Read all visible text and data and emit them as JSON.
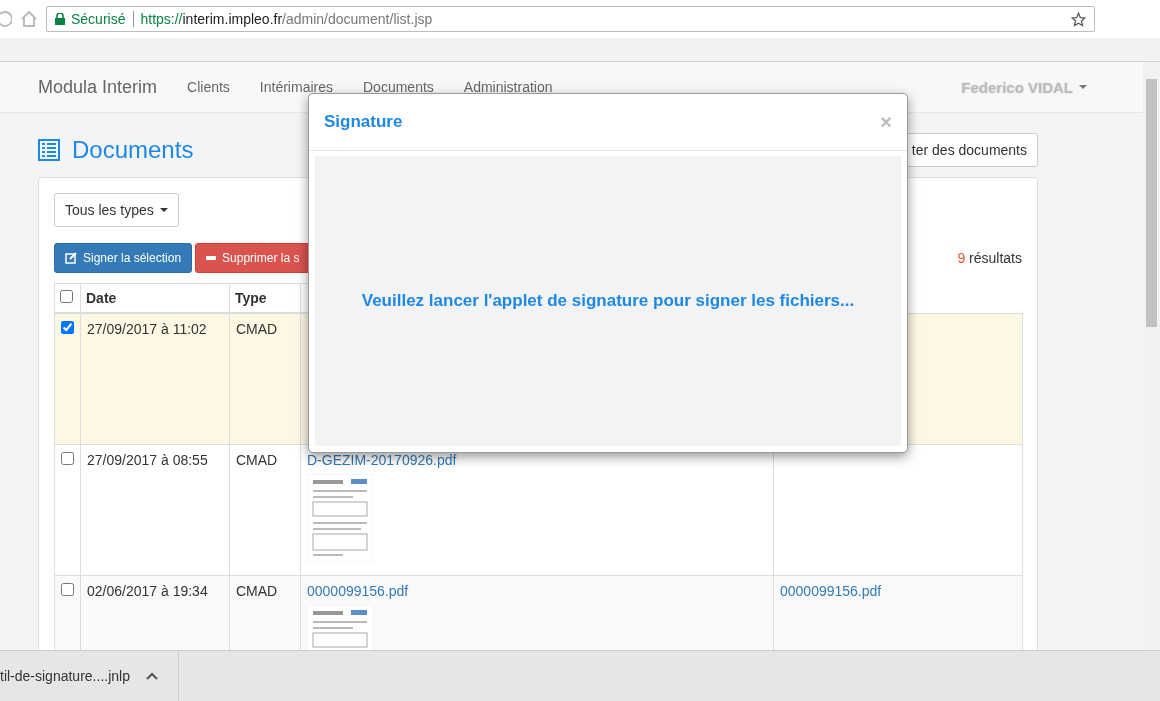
{
  "browser": {
    "secure_label": "Sécurisé",
    "url_scheme": "https://",
    "url_host": "interim.impleo.fr",
    "url_path": "/admin/document/list.jsp"
  },
  "navbar": {
    "brand": "Modula Interim",
    "links": [
      "Clients",
      "Intérimaires",
      "Documents",
      "Administration"
    ],
    "user": "Federico VIDAL"
  },
  "page": {
    "title": "Documents",
    "import_button": "ter des documents"
  },
  "filter": {
    "label": "Tous les types"
  },
  "actions": {
    "sign": "Signer la sélection",
    "delete": "Supprimer la s"
  },
  "results": {
    "count": "9",
    "label": "résultats"
  },
  "table": {
    "select_all": {
      "checked": false
    },
    "columns": [
      "Date",
      "Type"
    ],
    "rows": [
      {
        "checked": true,
        "date": "27/09/2017 à 11:02",
        "type": "CMAD",
        "thumbnail": false
      },
      {
        "checked": false,
        "date": "27/09/2017 à 08:55",
        "type": "CMAD",
        "name": "D-GEZIM-20170926.pdf",
        "thumbnail": true
      },
      {
        "checked": false,
        "date": "02/06/2017 à 19:34",
        "type": "CMAD",
        "name": "0000099156.pdf",
        "thumbnail": true,
        "name_2": "0000099156.pdf"
      }
    ]
  },
  "modal": {
    "title": "Signature",
    "close": "×",
    "message": "Veuillez lancer l'applet de signature pour signer les fichiers..."
  },
  "download_bar": {
    "file": "til-de-signature....jnlp"
  }
}
